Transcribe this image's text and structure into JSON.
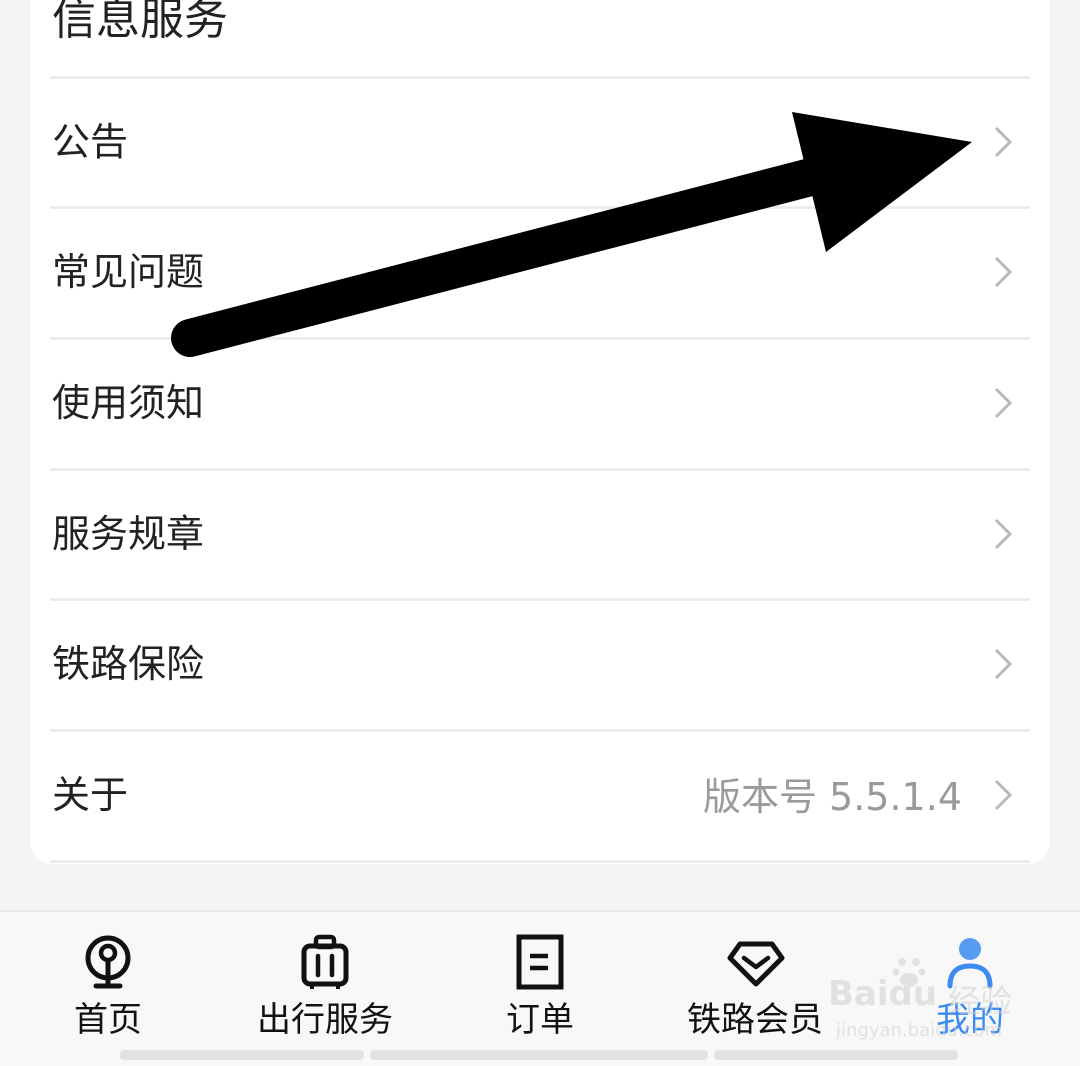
{
  "section": {
    "title": "信息服务"
  },
  "menu": [
    {
      "label": "公告",
      "value": ""
    },
    {
      "label": "常见问题",
      "value": ""
    },
    {
      "label": "使用须知",
      "value": ""
    },
    {
      "label": "服务规章",
      "value": ""
    },
    {
      "label": "铁路保险",
      "value": ""
    },
    {
      "label": "关于",
      "value": "版本号 5.5.1.4"
    }
  ],
  "tabs": [
    {
      "label": "首页",
      "icon": "railway-logo-icon"
    },
    {
      "label": "出行服务",
      "icon": "luggage-icon"
    },
    {
      "label": "订单",
      "icon": "order-document-icon"
    },
    {
      "label": "铁路会员",
      "icon": "diamond-icon"
    },
    {
      "label": "我的",
      "icon": "user-icon",
      "active": true
    }
  ],
  "watermark": {
    "brand": "Baidu",
    "text": "经验",
    "url": "jingyan.baidu.com"
  },
  "colors": {
    "accent": "#3b8bf0",
    "text": "#222222",
    "muted": "#9a9a9a",
    "divider": "#ececec"
  }
}
